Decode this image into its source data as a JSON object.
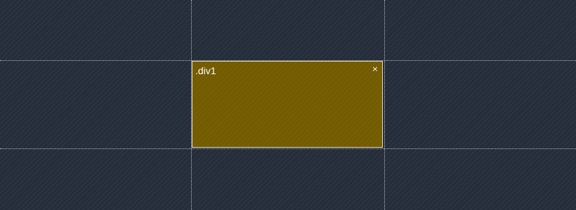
{
  "theme": {
    "background": "#252c3a",
    "area_fill": "#735b00",
    "guide_color": "#ebebeb",
    "text_color": "#ffffff"
  },
  "grid_area": {
    "label": ".div1",
    "close_symbol": "×",
    "close_icon": "close-icon"
  }
}
